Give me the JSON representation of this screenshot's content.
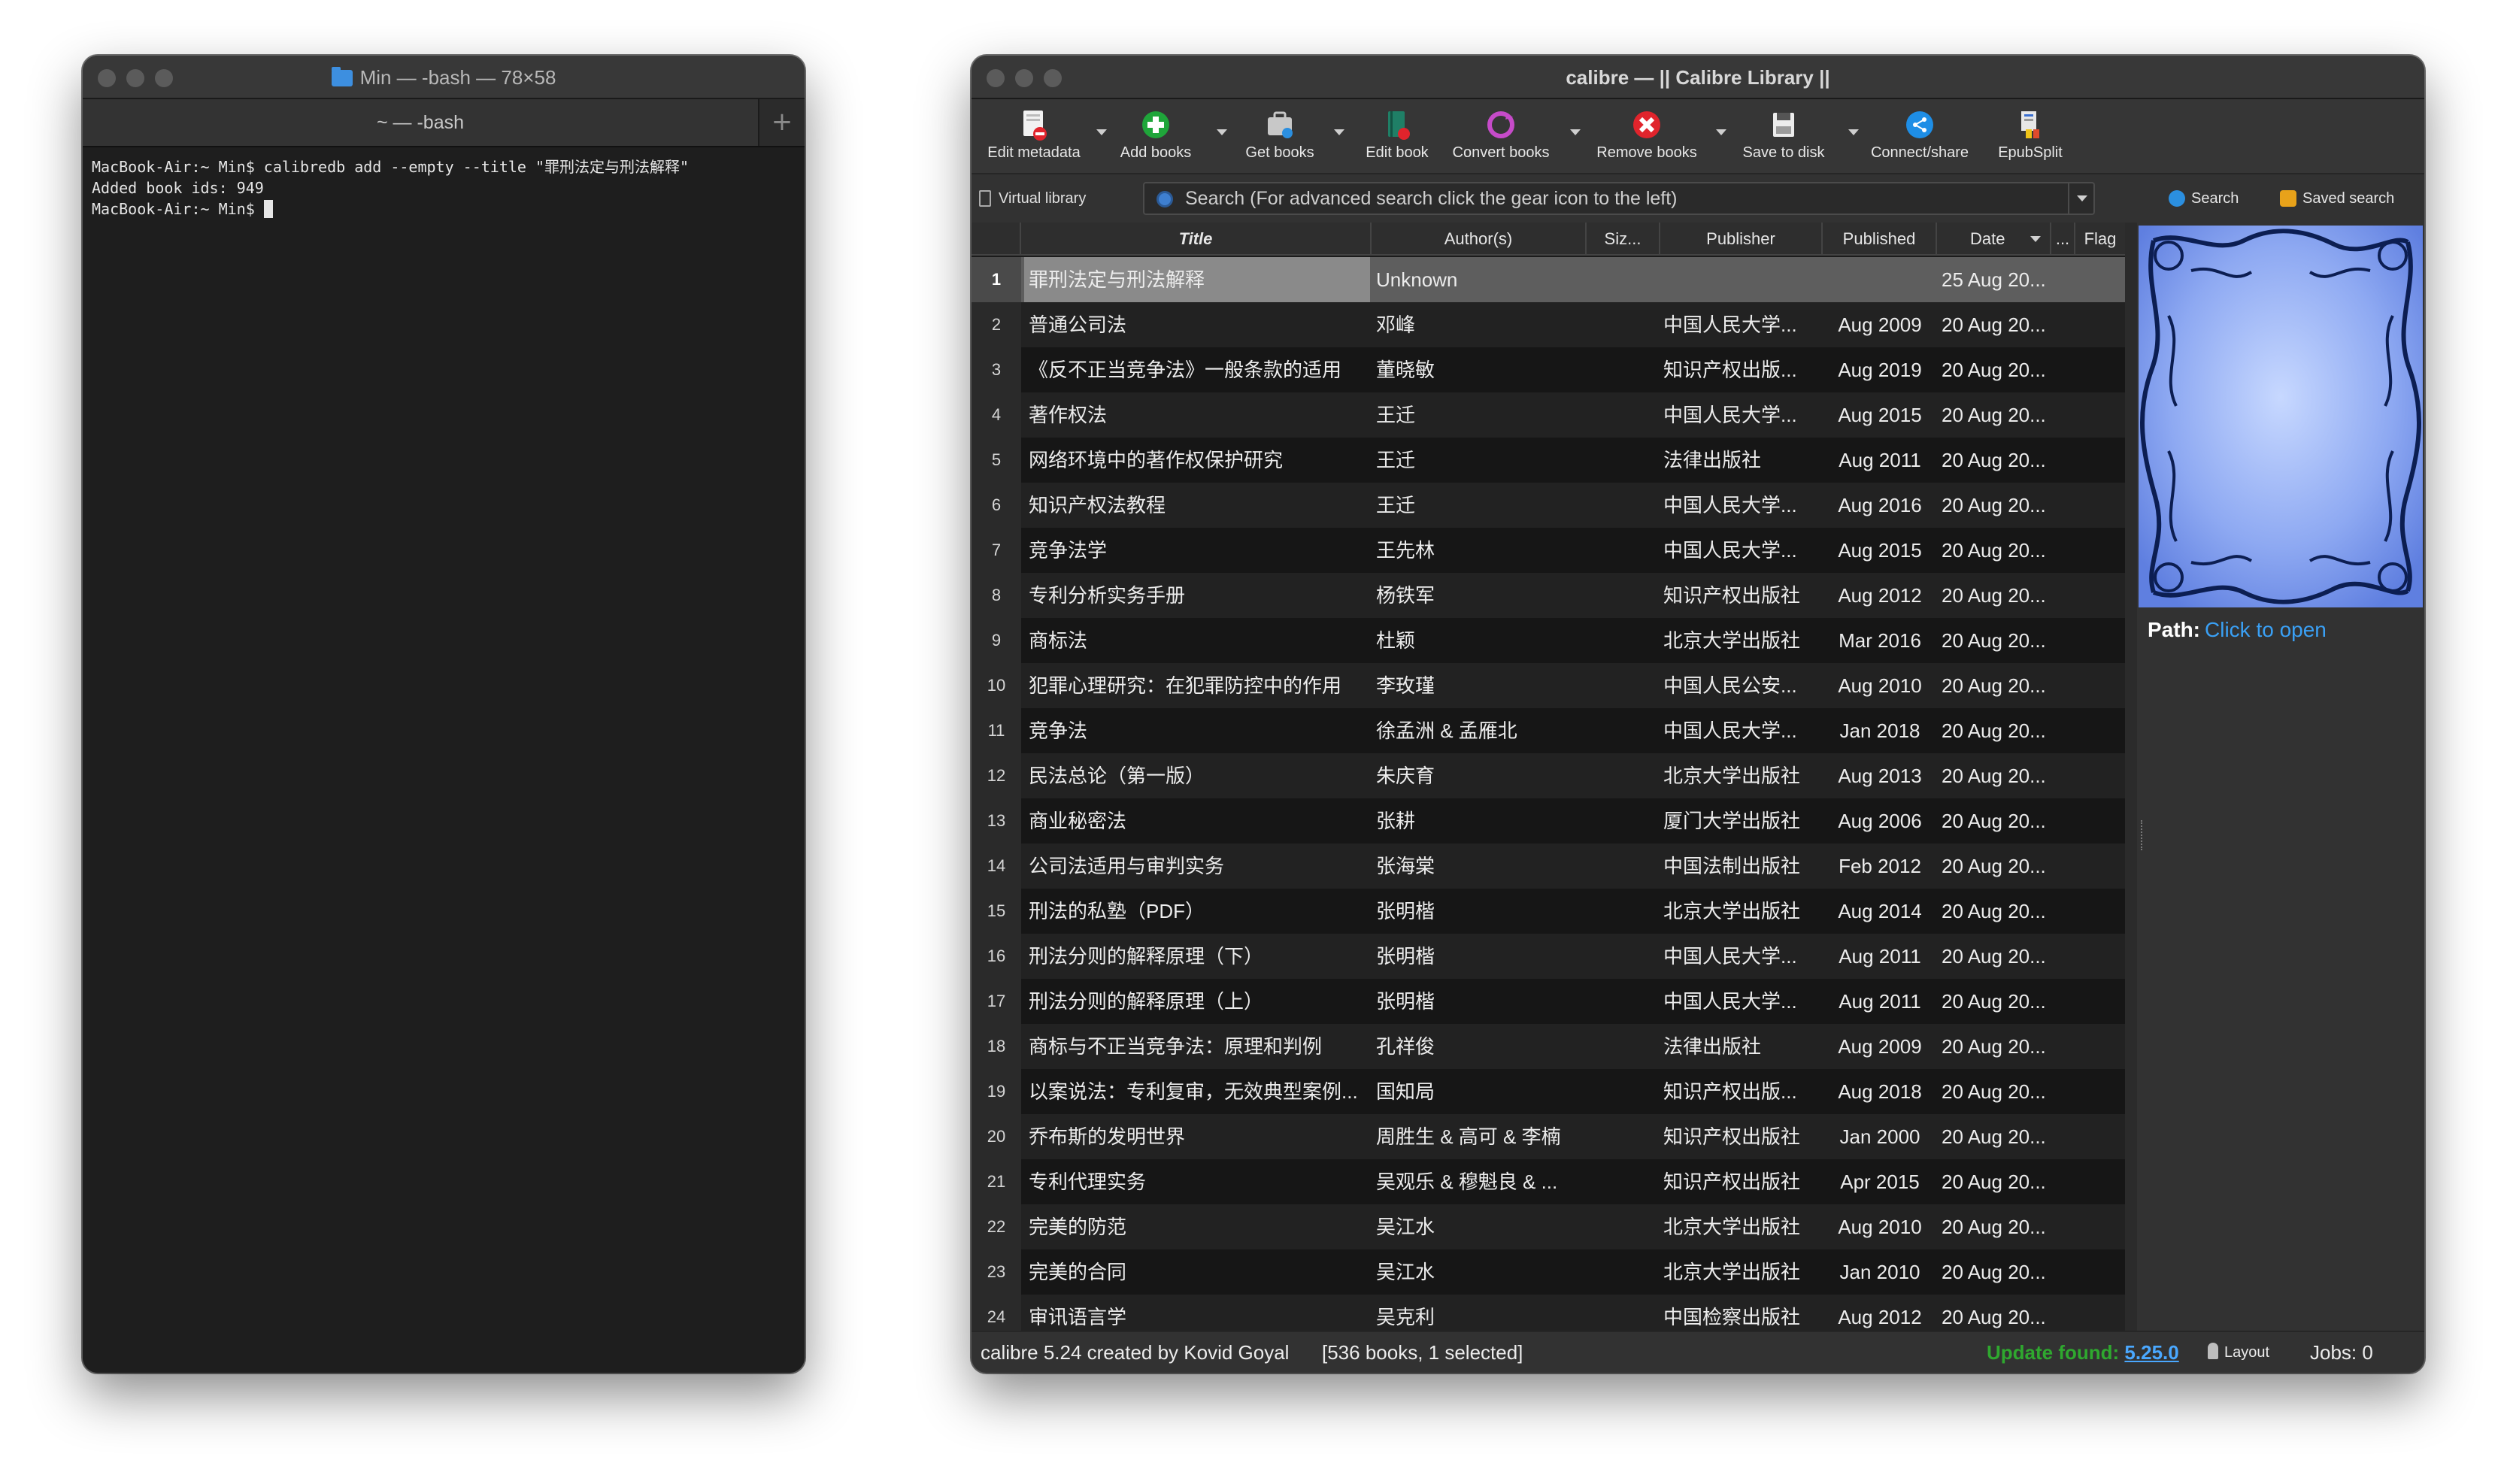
{
  "terminal": {
    "window_title": "Min — -bash — 78×58",
    "tab_label": "~ — -bash",
    "add_tab": "+",
    "lines": [
      "MacBook-Air:~ Min$ calibredb add --empty --title \"罪刑法定与刑法解释\"",
      "Added book ids: 949",
      "MacBook-Air:~ Min$ "
    ]
  },
  "calibre": {
    "window_title": "calibre — || Calibre Library ||",
    "toolbar": {
      "items": [
        {
          "label": "Edit metadata",
          "icon": "edit-metadata-icon"
        },
        {
          "label": "Add books",
          "icon": "add-books-icon"
        },
        {
          "label": "Get books",
          "icon": "get-books-icon"
        },
        {
          "label": "Edit book",
          "icon": "edit-book-icon"
        },
        {
          "label": "Convert books",
          "icon": "convert-books-icon"
        },
        {
          "label": "Remove books",
          "icon": "remove-books-icon"
        },
        {
          "label": "Save to disk",
          "icon": "save-to-disk-icon"
        },
        {
          "label": "Connect/share",
          "icon": "connect-share-icon"
        },
        {
          "label": "EpubSplit",
          "icon": "epubsplit-icon"
        }
      ]
    },
    "search": {
      "virtual_library": "Virtual library",
      "placeholder": "Search (For advanced search click the gear icon to the left)",
      "search_button": "Search",
      "saved_search": "Saved search"
    },
    "table": {
      "columns": [
        "",
        "Title",
        "Author(s)",
        "Siz...",
        "Publisher",
        "Published",
        "Date",
        "...",
        "Flag"
      ],
      "rows": [
        [
          "1",
          "罪刑法定与刑法解释",
          "Unknown",
          "",
          "",
          "",
          "25 Aug 20..."
        ],
        [
          "2",
          "普通公司法",
          "邓峰",
          "",
          "中国人民大学...",
          "Aug 2009",
          "20 Aug 20..."
        ],
        [
          "3",
          "《反不正当竞争法》一般条款的适用",
          "董晓敏",
          "",
          "知识产权出版...",
          "Aug 2019",
          "20 Aug 20..."
        ],
        [
          "4",
          "著作权法",
          "王迁",
          "",
          "中国人民大学...",
          "Aug 2015",
          "20 Aug 20..."
        ],
        [
          "5",
          "网络环境中的著作权保护研究",
          "王迁",
          "",
          "法律出版社",
          "Aug 2011",
          "20 Aug 20..."
        ],
        [
          "6",
          "知识产权法教程",
          "王迁",
          "",
          "中国人民大学...",
          "Aug 2016",
          "20 Aug 20..."
        ],
        [
          "7",
          "竞争法学",
          "王先林",
          "",
          "中国人民大学...",
          "Aug 2015",
          "20 Aug 20..."
        ],
        [
          "8",
          "专利分析实务手册",
          "杨铁军",
          "",
          "知识产权出版社",
          "Aug 2012",
          "20 Aug 20..."
        ],
        [
          "9",
          "商标法",
          "杜颖",
          "",
          "北京大学出版社",
          "Mar 2016",
          "20 Aug 20..."
        ],
        [
          "10",
          "犯罪心理研究：在犯罪防控中的作用",
          "李玫瑾",
          "",
          "中国人民公安...",
          "Aug 2010",
          "20 Aug 20..."
        ],
        [
          "11",
          "竞争法",
          "徐孟洲 & 孟雁北",
          "",
          "中国人民大学...",
          "Jan 2018",
          "20 Aug 20..."
        ],
        [
          "12",
          "民法总论（第一版）",
          "朱庆育",
          "",
          "北京大学出版社",
          "Aug 2013",
          "20 Aug 20..."
        ],
        [
          "13",
          "商业秘密法",
          "张耕",
          "",
          "厦门大学出版社",
          "Aug 2006",
          "20 Aug 20..."
        ],
        [
          "14",
          "公司法适用与审判实务",
          "张海棠",
          "",
          "中国法制出版社",
          "Feb 2012",
          "20 Aug 20..."
        ],
        [
          "15",
          "刑法的私塾（PDF）",
          "张明楷",
          "",
          "北京大学出版社",
          "Aug 2014",
          "20 Aug 20..."
        ],
        [
          "16",
          "刑法分则的解释原理（下）",
          "张明楷",
          "",
          "中国人民大学...",
          "Aug 2011",
          "20 Aug 20..."
        ],
        [
          "17",
          "刑法分则的解释原理（上）",
          "张明楷",
          "",
          "中国人民大学...",
          "Aug 2011",
          "20 Aug 20..."
        ],
        [
          "18",
          "商标与不正当竞争法：原理和判例",
          "孔祥俊",
          "",
          "法律出版社",
          "Aug 2009",
          "20 Aug 20..."
        ],
        [
          "19",
          "以案说法：专利复审，无效典型案例...",
          "国知局",
          "",
          "知识产权出版...",
          "Aug 2018",
          "20 Aug 20..."
        ],
        [
          "20",
          "乔布斯的发明世界",
          "周胜生 & 高可 & 李楠",
          "",
          "知识产权出版社",
          "Jan 2000",
          "20 Aug 20..."
        ],
        [
          "21",
          "专利代理实务",
          "吴观乐 & 穆魁良 & ...",
          "",
          "知识产权出版社",
          "Apr 2015",
          "20 Aug 20..."
        ],
        [
          "22",
          "完美的防范",
          "吴江水",
          "",
          "北京大学出版社",
          "Aug 2010",
          "20 Aug 20..."
        ],
        [
          "23",
          "完美的合同",
          "吴江水",
          "",
          "北京大学出版社",
          "Jan 2010",
          "20 Aug 20..."
        ],
        [
          "24",
          "审讯语言学",
          "吴克利",
          "",
          "中国检察出版社",
          "Aug 2012",
          "20 Aug 20..."
        ]
      ],
      "selected_row": 1
    },
    "details": {
      "path_label": "Path:",
      "path_link": "Click to open"
    },
    "status": {
      "credit": "calibre 5.24 created by Kovid Goyal",
      "count": "[536 books, 1 selected]",
      "update_label": "Update found:",
      "update_version": "5.25.0",
      "layout": "Layout",
      "jobs": "Jobs: 0"
    },
    "colors": {
      "accent_link": "#3aa0f5",
      "update_green": "#2fa82f"
    }
  }
}
